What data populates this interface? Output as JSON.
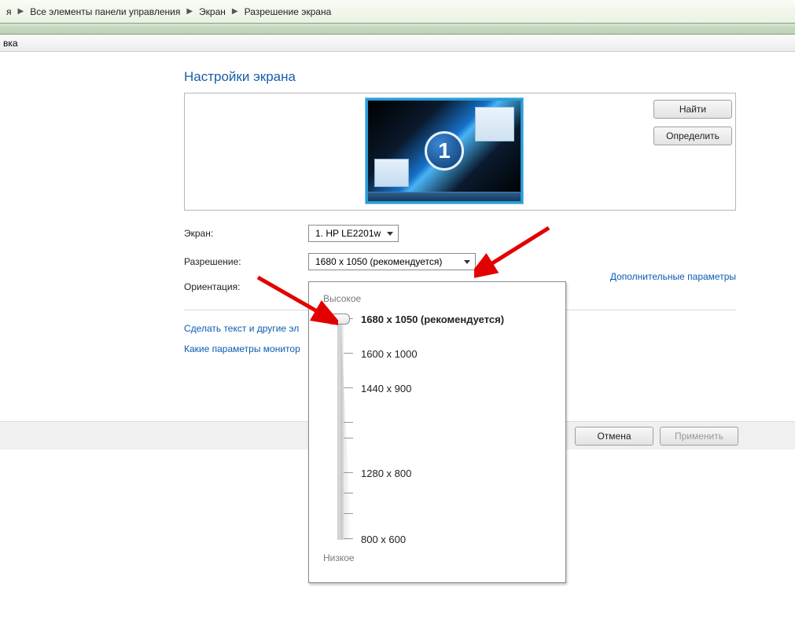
{
  "breadcrumb": {
    "part1_suffix": "я",
    "item1": "Все элементы панели управления",
    "item2": "Экран",
    "item3": "Разрешение экрана"
  },
  "menubar": {
    "item_suffix": "вка"
  },
  "page": {
    "title": "Настройки экрана"
  },
  "preview": {
    "display_number": "1",
    "find_label": "Найти",
    "detect_label": "Определить"
  },
  "form": {
    "screen_label": "Экран:",
    "screen_value": "1. HP LE2201w",
    "resolution_label": "Разрешение:",
    "resolution_value": "1680 x 1050 (рекомендуется)",
    "orientation_label": "Ориентация:"
  },
  "links": {
    "advanced": "Дополнительные параметры",
    "text_size_partial": "Сделать текст и другие эл",
    "monitor_params_partial": "Какие параметры монитор"
  },
  "buttons": {
    "cancel": "Отмена",
    "apply": "Применить"
  },
  "res_popup": {
    "high": "Высокое",
    "low": "Низкое",
    "opt0": "1680 x 1050 (рекомендуется)",
    "opt1": "1600 x 1000",
    "opt2": "1440 x 900",
    "opt3": "1280 x 800",
    "opt4": "800 x 600"
  }
}
